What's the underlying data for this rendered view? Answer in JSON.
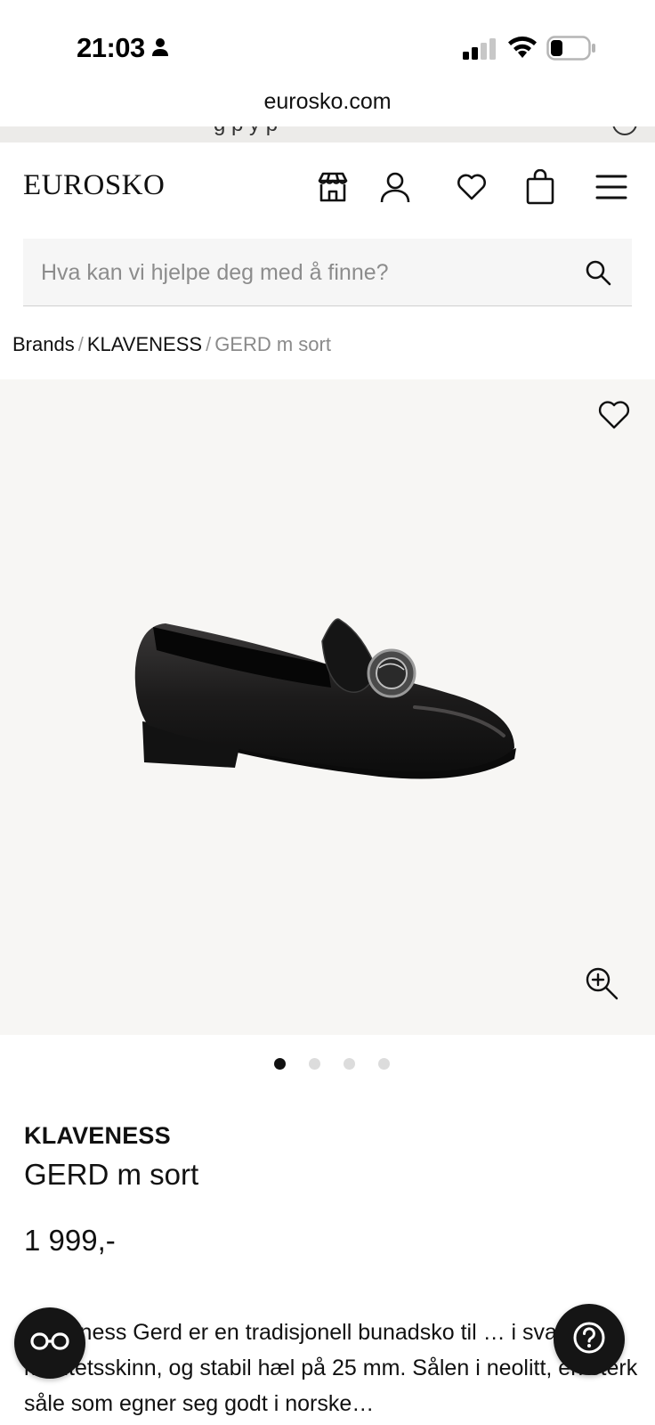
{
  "status_bar": {
    "time": "21:03",
    "icons": [
      "person-icon",
      "cellular-signal-icon",
      "wifi-icon",
      "battery-icon"
    ]
  },
  "browser": {
    "url": "eurosko.com"
  },
  "banner": {
    "text": "g p y p"
  },
  "header": {
    "logo": "EUROSKO",
    "icons": [
      "store-icon",
      "account-icon",
      "wishlist-heart-icon",
      "shopping-bag-icon",
      "menu-icon"
    ]
  },
  "search": {
    "placeholder": "Hva kan vi hjelpe deg med å finne?",
    "value": ""
  },
  "breadcrumb": {
    "items": [
      "Brands",
      "KLAVENESS"
    ],
    "current": "GERD m sort",
    "separator": "/"
  },
  "gallery": {
    "image_alt": "GERD m sort",
    "image_count": 4,
    "active_index": 0
  },
  "product": {
    "brand": "KLAVENESS",
    "name": "GERD m sort",
    "price": "1 999,-",
    "description": "Klaveness Gerd er en tradisjonell bunadsko til … i svart kvalitetsskinn, og stabil hæl på 25 mm. Sålen i neolitt, en sterk såle som egner seg godt i norske…"
  },
  "floating_buttons": {
    "left": "glasses-icon",
    "right": "help-question-icon"
  },
  "colors": {
    "gallery_bg": "#f7f6f4",
    "search_bg": "#f6f6f6",
    "fab_bg": "#151515",
    "text": "#111111"
  }
}
